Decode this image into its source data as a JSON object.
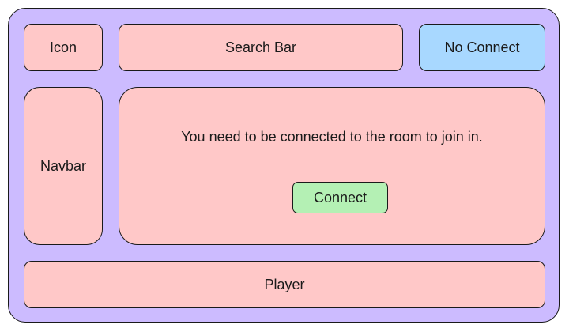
{
  "colors": {
    "frame_fill": "#ccbbff",
    "panel_fill": "#ffc8c8",
    "status_fill": "#a8d8ff",
    "button_fill": "#b4f0b4",
    "stroke": "#1a1a1a"
  },
  "header": {
    "icon_label": "Icon",
    "search_label": "Search Bar",
    "status_label": "No Connect"
  },
  "navbar": {
    "label": "Navbar"
  },
  "main": {
    "message": "You need to be connected to the room to join in.",
    "connect_label": "Connect"
  },
  "player": {
    "label": "Player"
  }
}
